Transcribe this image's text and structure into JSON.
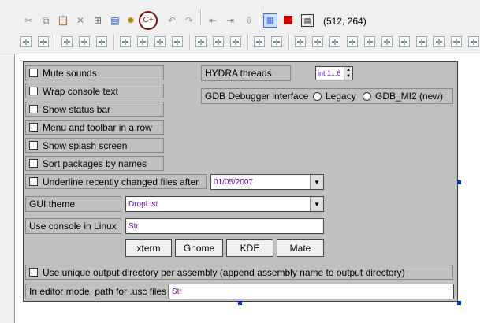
{
  "toolbar": {
    "coords": "(512, 264)"
  },
  "icons": {
    "cut": "✂",
    "copy": "⧉",
    "paste": "📋",
    "delete": "✕",
    "find": "⊞",
    "new": "▤",
    "settings": "✹",
    "compile": "C+",
    "undo": "↶",
    "redo": "↷",
    "stop": "■",
    "grid": "▦"
  },
  "options": {
    "mute_sounds": "Mute sounds",
    "wrap_console": "Wrap console text",
    "show_status_bar": "Show status bar",
    "menu_toolbar_row": "Menu and toolbar in a row",
    "show_splash": "Show splash screen",
    "sort_packages": "Sort packages by names",
    "underline_changed": "Underline recently changed files after",
    "underline_date": "01/05/2007",
    "gui_theme_label": "GUI theme",
    "gui_theme_value": "DropList",
    "console_linux_label": "Use console in Linux",
    "console_linux_value": "Str",
    "unique_output": "Use unique output directory per assembly (append assembly name to output directory)",
    "usc_path_label": "In editor mode, path for .usc files",
    "usc_path_value": "Str"
  },
  "hydra": {
    "label": "HYDRA threads",
    "value": "int 1...6"
  },
  "gdb": {
    "label": "GDB Debugger interface",
    "legacy": "Legacy",
    "mi2": "GDB_MI2 (new)"
  },
  "terminals": [
    "xterm",
    "Gnome",
    "KDE",
    "Mate"
  ],
  "colors": {
    "panel_bg": "#c0c0c0",
    "field_text": "#6a0dad",
    "selection_handle": "#0033cc",
    "stop_red": "#cc0000"
  }
}
